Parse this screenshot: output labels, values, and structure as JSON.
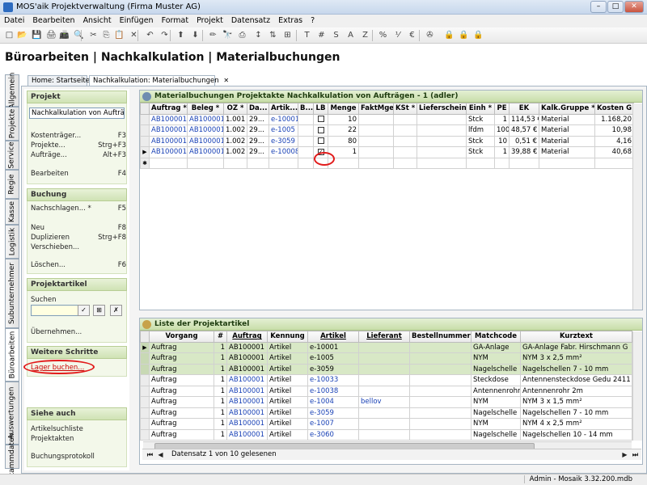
{
  "window": {
    "title": "MOS'aik Projektverwaltung (Firma Muster AG)",
    "minimize": "–",
    "maximize": "□",
    "close": "✕"
  },
  "menu": [
    "Datei",
    "Bearbeiten",
    "Ansicht",
    "Einfügen",
    "Format",
    "Projekt",
    "Datensatz",
    "Extras",
    "?"
  ],
  "toolbar": [
    "□",
    "📂",
    "💾",
    "🖨",
    "📠",
    "🔍",
    "✂",
    "⎘",
    "📋",
    "✕",
    "↶",
    "↷",
    "⬆",
    "⬇",
    "✏",
    "🔭",
    "⎙",
    "↕",
    "⇅",
    "⊞",
    "T",
    "#",
    "S",
    "A",
    "Z",
    "%",
    "⅟",
    "€",
    "✇",
    "🔒",
    "🔒",
    "🔒"
  ],
  "page_title": "Büroarbeiten | Nachkalkulation | Materialbuchungen",
  "vtabs": [
    "Allgemein",
    "Projekte",
    "Service",
    "Regie",
    "Kasse",
    "Logistik",
    "Subunternehmer",
    "Büroarbeiten",
    "Auswertungen",
    "Stammdaten"
  ],
  "doc_tabs": [
    {
      "label": "Home: Startseite"
    },
    {
      "label": "Nachkalkulation: Materialbuchungen",
      "close": "✕"
    }
  ],
  "leftpanel": {
    "projekt": {
      "title": "Projekt",
      "selected": "Nachkalkulation von Aufträgen",
      "items": [
        {
          "label": "Kostenträger...",
          "key": "F3"
        },
        {
          "label": "Projekte...",
          "key": "Strg+F3"
        },
        {
          "label": "Aufträge...",
          "key": "Alt+F3"
        },
        {
          "label": "Bearbeiten",
          "key": "F4"
        }
      ]
    },
    "buchung": {
      "title": "Buchung",
      "items": [
        {
          "label": "Nachschlagen... *",
          "key": "F5"
        },
        {
          "label": "Neu",
          "key": "F8"
        },
        {
          "label": "Duplizieren",
          "key": "Strg+F8"
        },
        {
          "label": "Verschieben...",
          "key": ""
        },
        {
          "label": "Löschen...",
          "key": "F6"
        }
      ]
    },
    "projektartikel": {
      "title": "Projektartikel",
      "search_label": "Suchen",
      "search_value": "",
      "btns": [
        "✓",
        "⊞",
        "✗"
      ],
      "uebernehmen": "Übernehmen..."
    },
    "weitere": {
      "title": "Weitere Schritte",
      "lager": "Lager buchen..."
    },
    "siehe": {
      "title": "Siehe auch",
      "items": [
        "Artikelsuchliste",
        "Projektakten",
        "Buchungsprotokoll"
      ]
    }
  },
  "upper_panel": {
    "title": "Materialbuchungen Projektakte Nachkalkulation von Aufträgen - 1 (adler)",
    "columns": [
      "Auftrag *",
      "Beleg *",
      "OZ *",
      "Da...",
      "Artik...",
      "B...",
      "LB",
      "Menge",
      "FaktMge",
      "KSt *",
      "Lieferschein",
      "Einh *",
      "PE",
      "EK",
      "Kalk.Gruppe *",
      "Kosten G"
    ],
    "rows": [
      {
        "marker": "",
        "cells": [
          "AB100001",
          "AB100001",
          "1.001",
          "29...",
          "e-10001",
          "",
          "",
          "10",
          "",
          "",
          "",
          "Stck",
          "1",
          "114,53 €",
          "Material",
          "1.168,20"
        ],
        "lb": false
      },
      {
        "marker": "",
        "cells": [
          "AB100001",
          "AB100001",
          "1.002",
          "29...",
          "e-1005",
          "",
          "",
          "22",
          "",
          "",
          "",
          "lfdm",
          "100",
          "48,57 €",
          "Material",
          "10,98"
        ],
        "lb": false
      },
      {
        "marker": "",
        "cells": [
          "AB100001",
          "AB100001",
          "1.002",
          "29...",
          "e-3059",
          "",
          "",
          "80",
          "",
          "",
          "",
          "Stck",
          "10",
          "0,51 €",
          "Material",
          "4,16"
        ],
        "lb": false
      },
      {
        "marker": "▶",
        "cells": [
          "AB100001",
          "AB100001",
          "1.002",
          "29...",
          "e-10008",
          "",
          "",
          "1",
          "",
          "",
          "",
          "Stck",
          "1",
          "39,88 €",
          "Material",
          "40,68"
        ],
        "lb": true
      }
    ],
    "new_row_marker": "✱",
    "checkmark": "✓"
  },
  "lower_panel": {
    "title": "Liste der Projektartikel",
    "columns": [
      "Vorgang",
      "#",
      "Auftrag",
      "Kennung",
      "Artikel",
      "Lieferant",
      "Bestellnummer",
      "Matchcode",
      "Kurztext"
    ],
    "rows": [
      {
        "marker": "▶",
        "green": true,
        "link": false,
        "cells": [
          "Auftrag",
          "1",
          "AB100001",
          "Artikel",
          "e-10001",
          "",
          "",
          "GA-Anlage",
          "GA-Anlage Fabr. Hirschmann G"
        ]
      },
      {
        "marker": "",
        "green": true,
        "link": false,
        "cells": [
          "Auftrag",
          "1",
          "AB100001",
          "Artikel",
          "e-1005",
          "",
          "",
          "NYM",
          "NYM 3 x 2,5 mm²"
        ]
      },
      {
        "marker": "",
        "green": true,
        "link": false,
        "cells": [
          "Auftrag",
          "1",
          "AB100001",
          "Artikel",
          "e-3059",
          "",
          "",
          "Nagelschelle",
          "Nagelschellen 7 - 10 mm"
        ]
      },
      {
        "marker": "",
        "green": false,
        "link": true,
        "cells": [
          "Auftrag",
          "1",
          "AB100001",
          "Artikel",
          "e-10033",
          "",
          "",
          "Steckdose",
          "Antennensteckdose Gedu 2411"
        ]
      },
      {
        "marker": "",
        "green": false,
        "link": true,
        "cells": [
          "Auftrag",
          "1",
          "AB100001",
          "Artikel",
          "e-10038",
          "",
          "",
          "Antennenrohr",
          "Antennenrohr 2m"
        ]
      },
      {
        "marker": "",
        "green": false,
        "link": true,
        "cells": [
          "Auftrag",
          "1",
          "AB100001",
          "Artikel",
          "e-1004",
          "bellov",
          "",
          "NYM",
          "NYM 3 x 1,5 mm²"
        ]
      },
      {
        "marker": "",
        "green": false,
        "link": true,
        "cells": [
          "Auftrag",
          "1",
          "AB100001",
          "Artikel",
          "e-3059",
          "",
          "",
          "Nagelschelle",
          "Nagelschellen 7 - 10 mm"
        ]
      },
      {
        "marker": "",
        "green": false,
        "link": true,
        "cells": [
          "Auftrag",
          "1",
          "AB100001",
          "Artikel",
          "e-1007",
          "",
          "",
          "NYM",
          "NYM 4 x 2,5 mm²"
        ]
      },
      {
        "marker": "",
        "green": false,
        "link": true,
        "cells": [
          "Auftrag",
          "1",
          "AB100001",
          "Artikel",
          "e-3060",
          "",
          "",
          "Nagelschelle",
          "Nagelschellen 10 - 14 mm"
        ]
      }
    ],
    "nav": {
      "first": "⏮",
      "prev": "◀",
      "next": "▶",
      "last": "⏭",
      "status": "Datensatz 1 von 10 gelesenen"
    }
  },
  "statusbar": "Admin - Mosaik 3.32.200.mdb",
  "colors": {
    "accent_green": "#c8dda9",
    "link_blue": "#1a42b6",
    "highlight_red": "#e21b1b"
  }
}
